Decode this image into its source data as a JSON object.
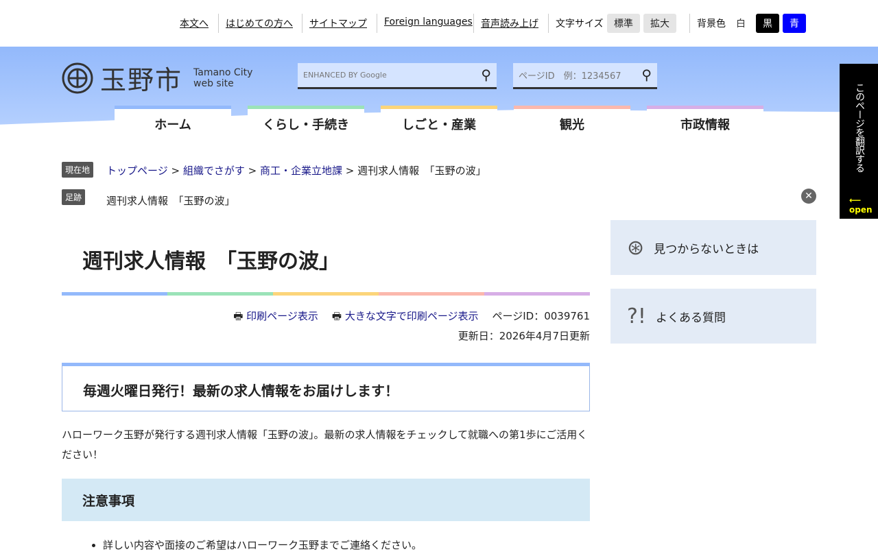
{
  "top": {
    "links": [
      "本文へ",
      "はじめての方へ",
      "サイトマップ",
      "Foreign languages",
      "音声読み上げ"
    ],
    "fontsize_label": "文字サイズ",
    "fs_standard": "標準",
    "fs_large": "拡大",
    "bg_label": "背景色",
    "bg_white": "白",
    "bg_black": "黒",
    "bg_blue": "青"
  },
  "logo": {
    "name": "玉野市",
    "en1": "Tamano City",
    "en2": "web site"
  },
  "search": {
    "google": "ENHANCED BY Google",
    "pageid_placeholder": "ページID　例：1234567"
  },
  "nav": [
    {
      "label": "ホーム",
      "color": "#93b9fb"
    },
    {
      "label": "くらし・手続き",
      "color": "#9be3b8"
    },
    {
      "label": "しごと・産業",
      "color": "#fcd57a"
    },
    {
      "label": "観光",
      "color": "#fbb8ad"
    },
    {
      "label": "市政情報",
      "color": "#d7aee6"
    }
  ],
  "translate": {
    "label": "このページを翻訳する",
    "open": "open"
  },
  "breadcrumb": {
    "tag": "現在地",
    "items": [
      "トップページ",
      "組織でさがす",
      "商工・企業立地課"
    ],
    "current": "週刊求人情報　「玉野の波」"
  },
  "footprint": {
    "tag": "足跡",
    "item": "週刊求人情報　「玉野の波」"
  },
  "main": {
    "title": "週刊求人情報　「玉野の波」",
    "print": "印刷ページ表示",
    "print_large": "大きな文字で印刷ページ表示",
    "page_id": "ページID：0039761",
    "updated": "更新日：2026年4月7日更新",
    "lead": "毎週火曜日発行！最新の求人情報をお届けします！",
    "body": "ハローワーク玉野が発行する週刊求人情報「玉野の波」。最新の求人情報をチェックして就職への第1歩にご活用ください！",
    "section": "注意事項",
    "bullet": "詳しい内容や面接のご希望はハローワーク玉野までご連絡ください。"
  },
  "sidebar": [
    "見つからないときは",
    "よくある質問"
  ]
}
